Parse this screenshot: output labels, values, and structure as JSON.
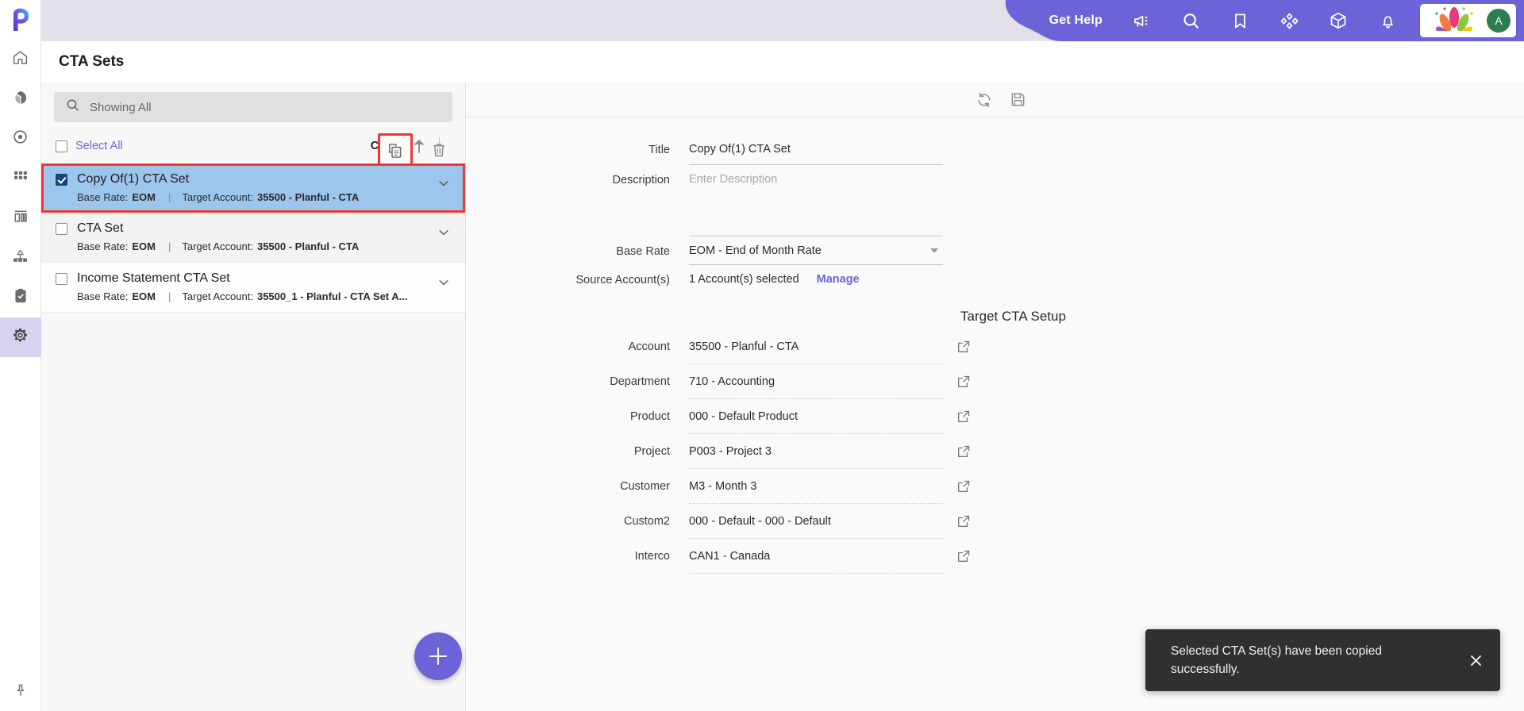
{
  "app": {
    "page_title": "CTA Sets",
    "accent_purple": "#6c63d8",
    "topbar_bg": "#e4e0ea",
    "selected_row_bg": "#9dc6ec",
    "highlight_red": "#f0372f"
  },
  "topbar": {
    "get_help": "Get Help",
    "icons": [
      "megaphone-icon",
      "search-icon",
      "bookmark-icon",
      "apps-icon",
      "cube-icon",
      "bell-icon"
    ],
    "avatar_initial": "A"
  },
  "rail": {
    "logo": "planful-logo",
    "items": [
      {
        "name": "home-icon",
        "active": false
      },
      {
        "name": "cube-icon",
        "active": false
      },
      {
        "name": "target-icon",
        "active": false
      },
      {
        "name": "grid-icon",
        "active": false
      },
      {
        "name": "bar-chart-icon",
        "active": false
      },
      {
        "name": "hierarchy-icon",
        "active": false
      },
      {
        "name": "clipboard-check-icon",
        "active": false
      },
      {
        "name": "gear-icon",
        "active": true
      }
    ],
    "pin": "pin-icon"
  },
  "list": {
    "search_placeholder": "Showing All",
    "search_value": "",
    "select_all_label": "Select All",
    "sort_label": "Code",
    "sort_direction": "ascending",
    "copy_button_label": "Copy",
    "delete_button_label": "Delete",
    "add_button_label": "Add",
    "items": [
      {
        "title": "Copy Of(1) CTA Set",
        "base_rate_label": "Base Rate:",
        "base_rate_value": "EOM",
        "target_label": "Target Account:",
        "target_value": "35500 - Planful - CTA",
        "checked": true,
        "selected": true
      },
      {
        "title": "CTA Set",
        "base_rate_label": "Base Rate:",
        "base_rate_value": "EOM",
        "target_label": "Target Account:",
        "target_value": "35500 - Planful - CTA",
        "checked": false,
        "selected": false
      },
      {
        "title": "Income Statement CTA Set",
        "base_rate_label": "Base Rate:",
        "base_rate_value": "EOM",
        "target_label": "Target Account:",
        "target_value": "35500_1 - Planful - CTA Set A...",
        "checked": false,
        "selected": false
      }
    ]
  },
  "detail": {
    "toolbar": {
      "refresh_label": "Refresh",
      "save_label": "Save"
    },
    "fields": {
      "title_label": "Title",
      "title_value": "Copy Of(1) CTA Set",
      "description_label": "Description",
      "description_value": "",
      "description_placeholder": "Enter Description",
      "base_rate_label": "Base Rate",
      "base_rate_value": "EOM - End of Month Rate",
      "source_accounts_label": "Source Account(s)",
      "source_accounts_value": "1 Account(s) selected",
      "manage_link": "Manage"
    },
    "target_section_title": "Target CTA Setup",
    "target_rows": [
      {
        "label": "Account",
        "value": "35500 - Planful - CTA"
      },
      {
        "label": "Department",
        "value": "710 - Accounting"
      },
      {
        "label": "Product",
        "value": "000 - Default Product"
      },
      {
        "label": "Project",
        "value": "P003 - Project 3"
      },
      {
        "label": "Customer",
        "value": "M3 - Month 3"
      },
      {
        "label": "Custom2",
        "value": "000 - Default - 000 - Default"
      },
      {
        "label": "Interco",
        "value": "CAN1 - Canada"
      }
    ]
  },
  "toast": {
    "message": "Selected CTA Set(s) have been copied successfully.",
    "close_label": "Close"
  }
}
